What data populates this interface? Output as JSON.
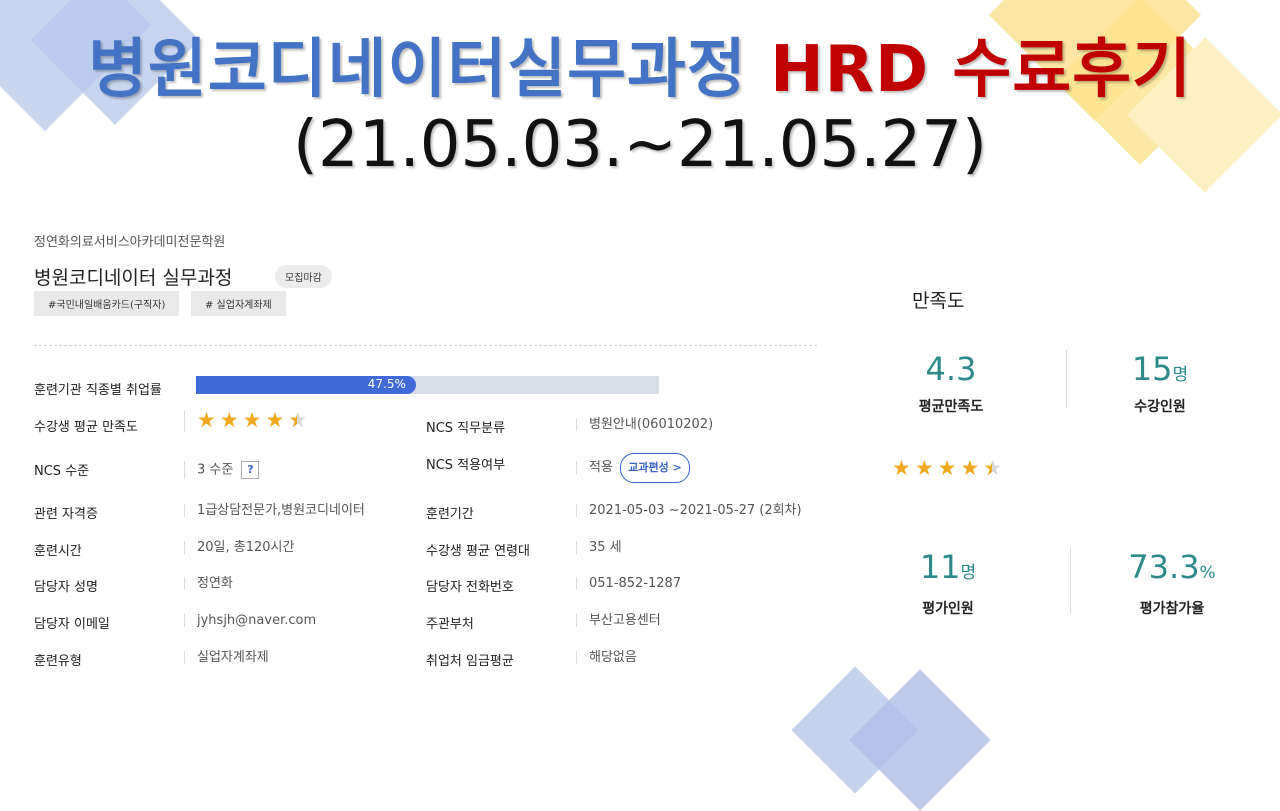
{
  "slide": {
    "title_blue": "병원코디네이터실무과정",
    "title_red": "HRD 수료후기",
    "period": "(21.05.03.~21.05.27)"
  },
  "course": {
    "institution": "정연화의료서비스아카데미전문학원",
    "name": "병원코디네이터 실무과정",
    "status": "모집마감",
    "tags": [
      "#국민내일배움카드(구직자)",
      "# 실업자계좌제"
    ]
  },
  "details": {
    "employment_rate_label": "훈련기관 직종별 취업률",
    "employment_rate": 47.5,
    "employment_rate_text": "47.5%",
    "satisfaction_label": "수강생 평균 만족도",
    "satisfaction_rating": 4.3,
    "ncs_job_label": "NCS 직무분류",
    "ncs_job_value": "병원안내(06010202)",
    "ncs_level_label": "NCS 수준",
    "ncs_level_value": "3 수준",
    "ncs_level_help": "?",
    "ncs_apply_label": "NCS 적용여부",
    "ncs_apply_value": "적용",
    "curriculum_button": "교과편성 >",
    "cert_label": "관련 자격증",
    "cert_value": "1급상담전문가,병원코디네이터",
    "period_label": "훈련기간",
    "period_value": "2021-05-03 ~2021-05-27 (2회차)",
    "hours_label": "훈련시간",
    "hours_value": "20일, 총120시간",
    "age_label": "수강생 평균 연령대",
    "age_value": "35 세",
    "manager_label": "담당자 성명",
    "manager_value": "정연화",
    "phone_label": "담당자 전화번호",
    "phone_value": "051-852-1287",
    "email_label": "담당자 이메일",
    "email_value": "jyhsjh@naver.com",
    "dept_label": "주관부처",
    "dept_value": "부산고용센터",
    "type_label": "훈련유형",
    "type_value": "실업자계좌제",
    "wage_label": "취업처 임금평균",
    "wage_value": "해당없음"
  },
  "satisfaction": {
    "title": "만족도",
    "avg_value": "4.3",
    "avg_label": "평균만족도",
    "students_value": "15",
    "students_unit": "명",
    "students_label": "수강인원",
    "rating": 4.3,
    "evaluators_value": "11",
    "evaluators_unit": "명",
    "evaluators_label": "평가인원",
    "participation_value": "73.3",
    "participation_unit": "%",
    "participation_label": "평가참가율"
  },
  "colors": {
    "title_blue": "#4472c4",
    "title_red": "#c00000",
    "bar_fill": "#3f6ad8",
    "star": "#f0a81e",
    "teal": "#2e8a8a"
  }
}
